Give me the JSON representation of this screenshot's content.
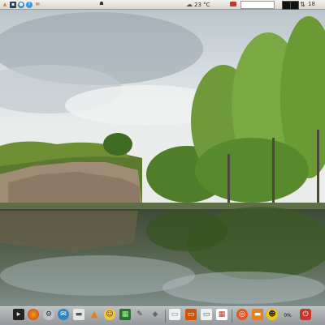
{
  "top_panel": {
    "weather": {
      "temperature": "23 °C",
      "icon": "cloudy-sun-icon"
    },
    "clock": "18",
    "search": {
      "value": ""
    },
    "icons": [
      "home-icon",
      "terminal-icon",
      "browser-icon",
      "help-icon",
      "network-icon",
      "tux-icon"
    ]
  },
  "dock": {
    "battery": "0%",
    "icons": [
      "terminal-icon",
      "firefox-icon",
      "settings-icon",
      "thunderbird-icon",
      "folder-icon",
      "vlc-icon",
      "system-monitor-icon",
      "chat-icon",
      "package-icon",
      "photo-viewer-icon",
      "calendar-icon",
      "ubuntu-icon",
      "files-icon",
      "smiley-icon",
      "power-icon"
    ]
  },
  "colors": {
    "panel": "#e6e3dd",
    "water": "#4a5a46",
    "foliage": "#6f9a3a",
    "sky": "#c9d3d8"
  }
}
